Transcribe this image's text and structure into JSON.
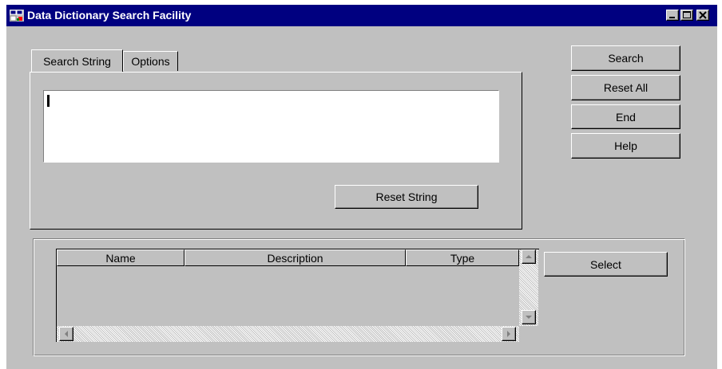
{
  "window": {
    "title": "Data Dictionary Search Facility",
    "title_bar_color": "#000080",
    "face_color": "#c0c0c0",
    "icons": [
      "app-icon",
      "minimize-icon",
      "maximize-icon",
      "close-icon"
    ]
  },
  "tabs": [
    {
      "label": "Search String",
      "active": true
    },
    {
      "label": "Options",
      "active": false
    }
  ],
  "search": {
    "value": "",
    "reset_label": "Reset String"
  },
  "actions": {
    "search_label": "Search",
    "reset_all_label": "Reset All",
    "end_label": "End",
    "help_label": "Help"
  },
  "results": {
    "columns": [
      "Name",
      "Description",
      "Type"
    ],
    "rows": [],
    "select_label": "Select"
  }
}
